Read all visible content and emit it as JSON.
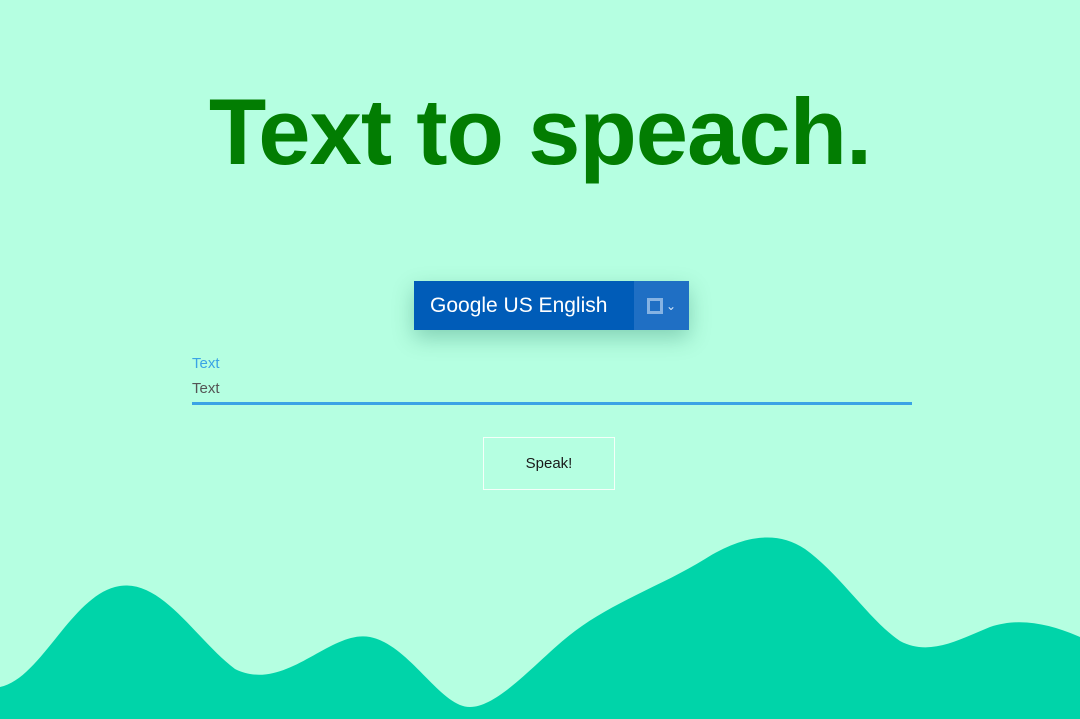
{
  "title": "Text to speach.",
  "voice_select": {
    "selected": "Google US English",
    "toggle_icon": "checkbox-dropdown-icon"
  },
  "text_field": {
    "label": "Text",
    "placeholder": "Text",
    "value": ""
  },
  "speak_button": {
    "label": "Speak!"
  },
  "colors": {
    "background": "#b5ffe1",
    "title": "#027d02",
    "select_bg": "#005cb8",
    "accent": "#3aa3e5",
    "wave": "#00d4a9"
  }
}
